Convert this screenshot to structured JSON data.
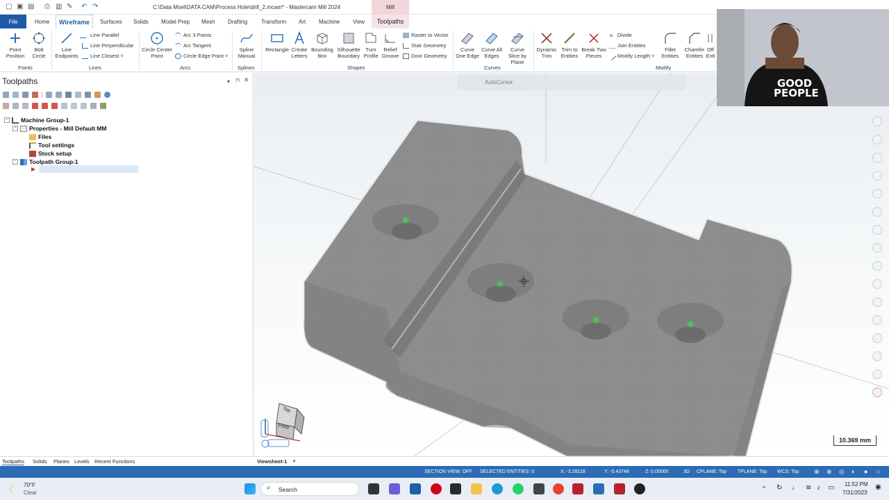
{
  "window": {
    "title": "C:\\Data Moel\\DATA CAM\\Process Hole\\drill_2.mcam* - Mastercam Mill 2024",
    "context_tab": "Mill"
  },
  "tabs": [
    {
      "label": "File"
    },
    {
      "label": "Home"
    },
    {
      "label": "Wireframe"
    },
    {
      "label": "Surfaces"
    },
    {
      "label": "Solids"
    },
    {
      "label": "Model Prep"
    },
    {
      "label": "Mesh"
    },
    {
      "label": "Drafting"
    },
    {
      "label": "Transform"
    },
    {
      "label": "Art"
    },
    {
      "label": "Machine"
    },
    {
      "label": "View"
    },
    {
      "label": "Toolpaths"
    }
  ],
  "ribbon": {
    "groups": {
      "points": "Points",
      "lines": "Lines",
      "arcs": "Arcs",
      "splines": "Splines",
      "shapes": "Shapes",
      "curves": "Curves",
      "modify": "Modify"
    },
    "point_position": "Point Position",
    "bolt_circle": "Bolt Circle",
    "line_endpoints": "Line Endpoints",
    "line_parallel": "Line Parallel",
    "line_perpendicular": "Line Perpendicular",
    "line_closest": "Line Closest",
    "circle_center_point": "Circle Center Point",
    "arc_3_points": "Arc 3 Points",
    "arc_tangent": "Arc Tangent",
    "circle_edge_point": "Circle Edge Point",
    "spline_manual": "Spline Manual",
    "rectangle": "Rectangle",
    "create_letters": "Create Letters",
    "bounding_box": "Bounding Box",
    "silhouette_boundary": "Silhouette Boundary",
    "turn_profile": "Turn Profile",
    "relief_groove": "Relief Groove",
    "raster_to_vector": "Raster to Vector",
    "stair_geometry": "Stair Geometry",
    "door_geometry": "Door Geometry",
    "curve_one_edge": "Curve One Edge",
    "curve_all_edges": "Curve All Edges",
    "curve_slice_by_plane": "Curve Slice by Plane",
    "dynamic_trim": "Dynamic Trim",
    "trim_to_entities": "Trim to Entities",
    "break_two_pieces": "Break Two Pieces",
    "divide": "Divide",
    "join_entities": "Join Entities",
    "modify_length": "Modify Length",
    "fillet_entities": "Fillet Entities",
    "chamfer_entities": "Chamfer Entities",
    "offset_entities": "Off Enti"
  },
  "panel": {
    "title": "Toolpaths",
    "tree": [
      {
        "label": "Machine Group-1"
      },
      {
        "label": "Properties - Mill Default MM"
      },
      {
        "label": "Files"
      },
      {
        "label": "Tool settings"
      },
      {
        "label": "Stock setup"
      },
      {
        "label": "Toolpath Group-1"
      }
    ]
  },
  "bottom_tabs": [
    "Toolpaths",
    "Solids",
    "Planes",
    "Levels",
    "Recent Functions"
  ],
  "viewsheet": "Viewsheet-1",
  "viewport": {
    "autocursor": "AutoCursor",
    "scale": "10.369 mm",
    "viewcube": {
      "top": "Top",
      "front": "Front"
    }
  },
  "status": {
    "section_view": "SECTION VIEW: OFF",
    "selected": "SELECTED ENTITIES: 0",
    "x": "X:   -3.28118",
    "y": "Y:   -5.43748",
    "z": "Z:   0.00000",
    "mode": "3D",
    "cplane": "CPLANE: Top",
    "tplane": "TPLANE: Top",
    "wcs": "WCS: Top"
  },
  "taskbar": {
    "temp": "70°F",
    "weather": "Clear",
    "search": "Search",
    "time": "11:52 PM",
    "date": "7/31/2023"
  },
  "webcam": {
    "shirt_text": "GOOD PEOPLE"
  }
}
